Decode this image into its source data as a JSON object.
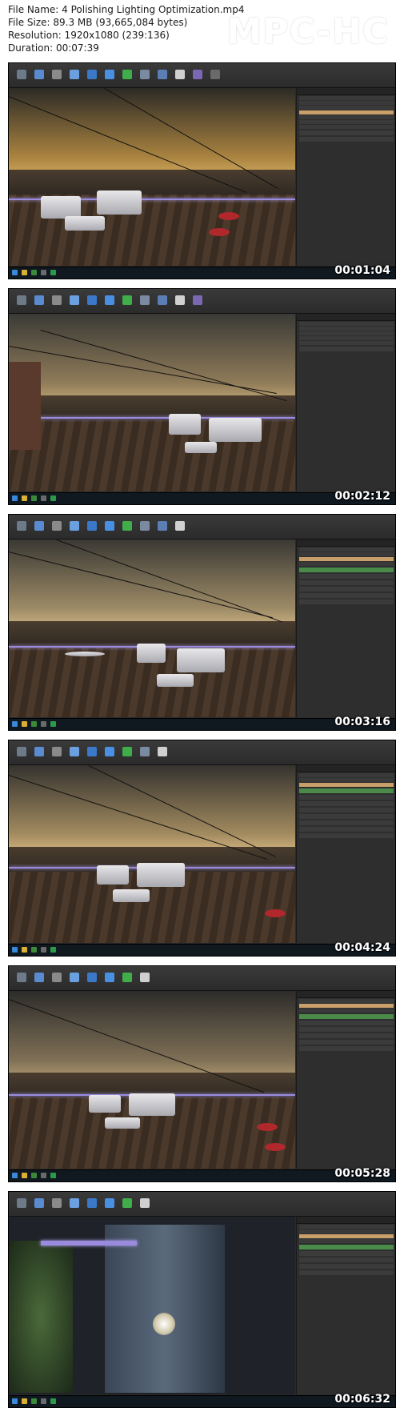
{
  "header": {
    "file_name": "File Name: 4 Polishing Lighting Optimization.mp4",
    "file_size": "File Size: 89.3 MB (93,665,084 bytes)",
    "resolution": "Resolution: 1920x1080 (239:136)",
    "duration": "Duration: 00:07:39",
    "brand": "MPC-HC"
  },
  "thumbnails": [
    {
      "timestamp": "00:01:04",
      "scene": "rooftop-lounge",
      "sky_color": "#a8823f"
    },
    {
      "timestamp": "00:02:12",
      "scene": "rooftop-deck",
      "sky_color": "#8e7a58"
    },
    {
      "timestamp": "00:03:16",
      "scene": "rooftop-deck",
      "sky_color": "#9c8a66"
    },
    {
      "timestamp": "00:04:24",
      "scene": "rooftop-deck",
      "sky_color": "#a28a5f"
    },
    {
      "timestamp": "00:05:28",
      "scene": "rooftop-deck",
      "sky_color": "#7e6f55"
    },
    {
      "timestamp": "00:06:32",
      "scene": "wall-closeup",
      "sky_color": "#3a4250"
    }
  ],
  "colors": {
    "toolbar": "#2e2e2e",
    "panel": "#2e2e2e",
    "selected_row": "#c9a06a",
    "rail_light": "#9b8bdf"
  }
}
